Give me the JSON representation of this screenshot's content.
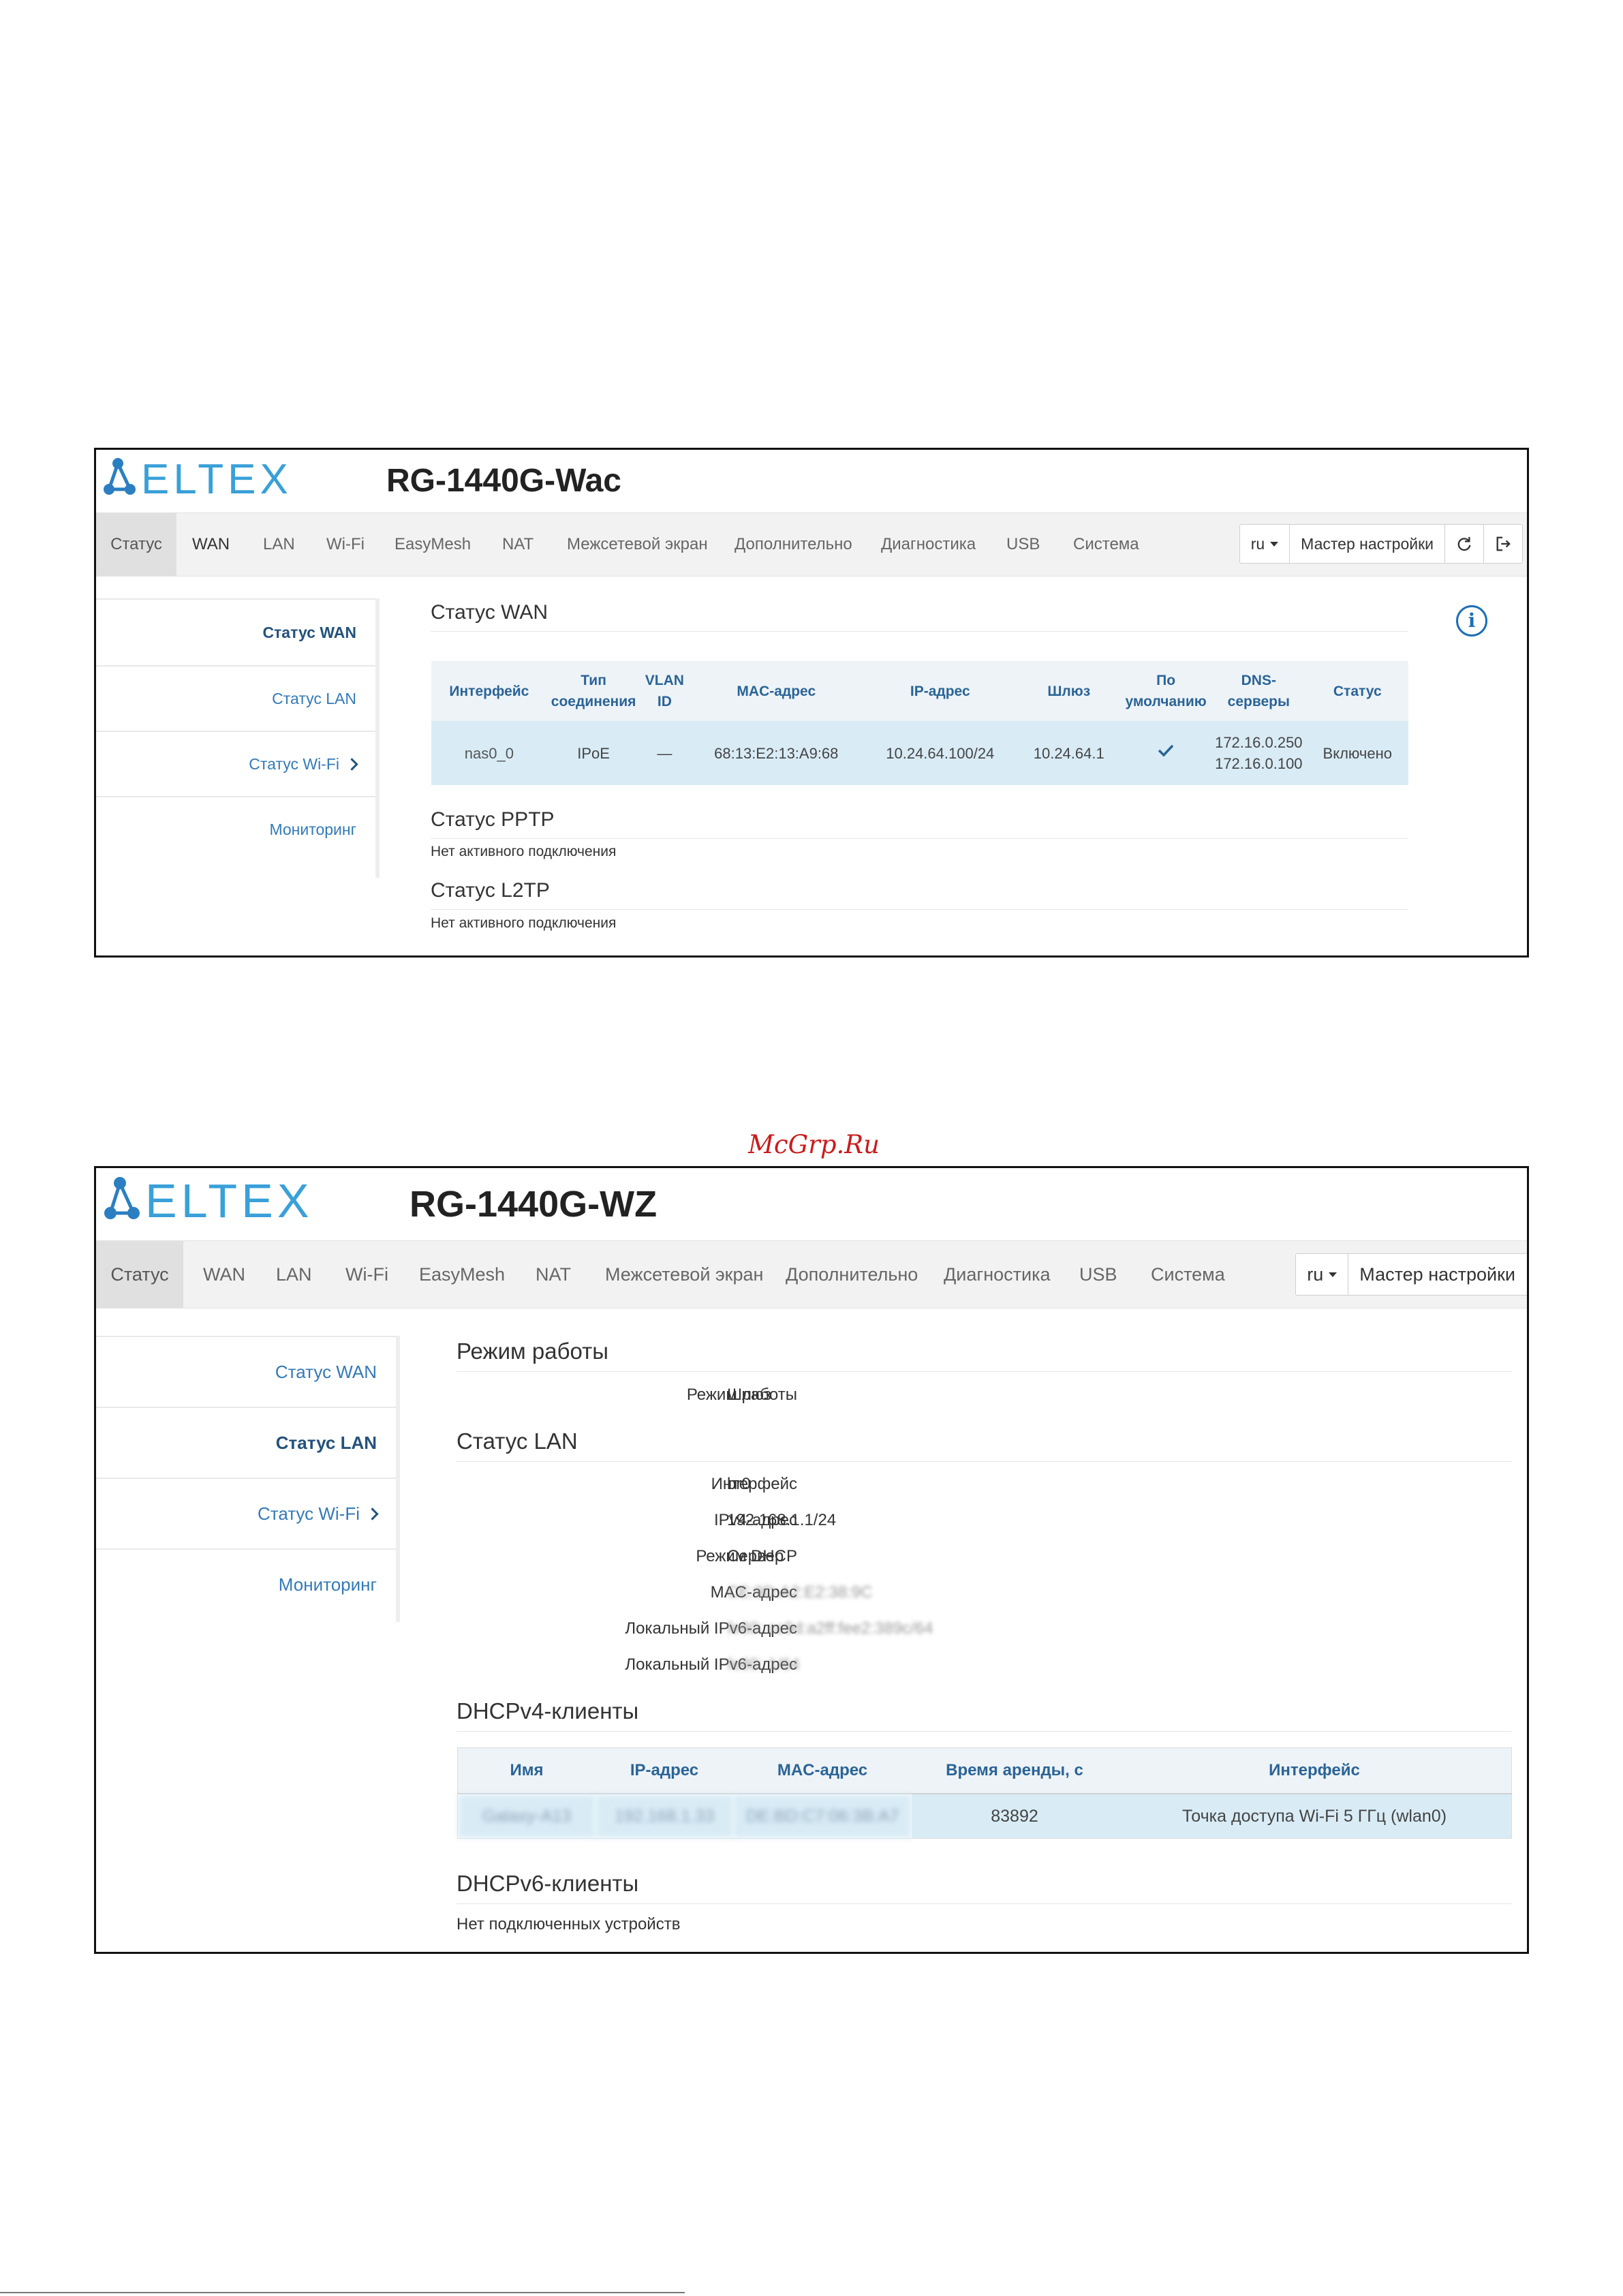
{
  "watermark": "McGrp.Ru",
  "screens": [
    {
      "logo_text": "ELTEX",
      "device": "RG-1440G-Wac",
      "nav": [
        "Статус",
        "WAN",
        "LAN",
        "Wi-Fi",
        "EasyMesh",
        "NAT",
        "Межсетевой экран",
        "Дополнительно",
        "Диагностика",
        "USB",
        "Система"
      ],
      "lang": "ru",
      "wizard": "Мастер настройки",
      "sidebar": [
        "Статус WAN",
        "Статус LAN",
        "Статус Wi-Fi",
        "Мониторинг"
      ],
      "wan_title": "Статус WAN",
      "wan_headers": [
        "Интерфейс",
        "Тип соединения",
        "VLAN ID",
        "MAC-адрес",
        "IP-адрес",
        "Шлюз",
        "По умолчанию",
        "DNS-серверы",
        "Статус"
      ],
      "wan_row": {
        "interface": "nas0_0",
        "type": "IPoE",
        "vlan": "—",
        "mac": "68:13:E2:13:A9:68",
        "ip": "10.24.64.100/24",
        "gw": "10.24.64.1",
        "dns1": "172.16.0.250",
        "dns2": "172.16.0.100",
        "status": "Включено"
      },
      "pptp_title": "Статус PPTP",
      "pptp_text": "Нет активного подключения",
      "l2tp_title": "Статус L2TP",
      "l2tp_text": "Нет активного подключения"
    },
    {
      "logo_text": "ELTEX",
      "device": "RG-1440G-WZ",
      "nav": [
        "Статус",
        "WAN",
        "LAN",
        "Wi-Fi",
        "EasyMesh",
        "NAT",
        "Межсетевой экран",
        "Дополнительно",
        "Диагностика",
        "USB",
        "Система"
      ],
      "lang": "ru",
      "wizard": "Мастер настройки",
      "sidebar": [
        "Статус WAN",
        "Статус LAN",
        "Статус Wi-Fi",
        "Мониторинг"
      ],
      "mode_title": "Режим работы",
      "mode_label": "Режим работы",
      "mode_value": "Шлюз",
      "lan_title": "Статус LAN",
      "lan_rows": [
        {
          "label": "Интерфейс",
          "value": "br0"
        },
        {
          "label": "IPv4-адрес",
          "value": "192.168.1.1/24"
        },
        {
          "label": "Режим DHCP",
          "value": "Сервер"
        },
        {
          "label": "MAC-адрес",
          "value": "CE:9D:A2:E2:38:9C"
        },
        {
          "label": "Локальный IPv6-адрес",
          "value": "fe80::cc9d:a2ff:fee2:389c/64"
        },
        {
          "label": "Локальный IPv6-адрес",
          "value": "fe80::1/64"
        }
      ],
      "dhcp4_title": "DHCPv4-клиенты",
      "dhcp4_headers": [
        "Имя",
        "IP-адрес",
        "MAC-адрес",
        "Время аренды, с",
        "Интерфейс"
      ],
      "dhcp4_row": {
        "name": "Galaxy-A13",
        "ip": "192.168.1.33",
        "mac": "DE:BD:C7:06:3B:A7",
        "lease": "83892",
        "iface": "Точка доступа Wi-Fi 5 ГГц (wlan0)"
      },
      "dhcp6_title": "DHCPv6-клиенты",
      "dhcp6_text": "Нет подключенных устройств"
    }
  ]
}
